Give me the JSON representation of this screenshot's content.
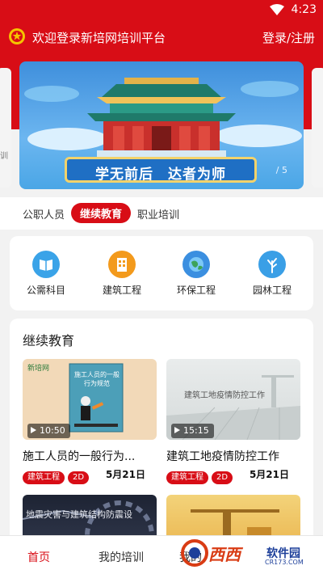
{
  "status": {
    "time": "4:23"
  },
  "header": {
    "title": "欢迎登录新培网培训平台",
    "login": "登录/注册"
  },
  "banner": {
    "slogan": "学无前后　达者为师",
    "counter": "/ 5",
    "side_text": "训"
  },
  "tabs": [
    "公职人员",
    "继续教育",
    "职业培训"
  ],
  "categories": [
    {
      "label": "公需科目",
      "color": "#3aa3e8",
      "icon": "book-icon"
    },
    {
      "label": "建筑工程",
      "color": "#f39a1c",
      "icon": "building-icon"
    },
    {
      "label": "环保工程",
      "color": "#3b8fe0",
      "icon": "globe-icon"
    },
    {
      "label": "园林工程",
      "color": "#3a9fe6",
      "icon": "tree-icon"
    }
  ],
  "section": {
    "title": "继续教育"
  },
  "courses": [
    {
      "title": "施工人员的一般行为...",
      "duration": "10:50",
      "tag1": "建筑工程",
      "tag2": "2D",
      "date": "5月21日",
      "thumb_text": "施工人员的一般行为规范",
      "thumb_brand": "新培网"
    },
    {
      "title": "建筑工地疫情防控工作",
      "duration": "15:15",
      "tag1": "建筑工程",
      "tag2": "2D",
      "date": "5月21日",
      "thumb_text": "建筑工地疫情防控工作"
    },
    {
      "thumb_text": "地震灾害与建筑结构防震设"
    },
    {
      "thumb_text": ""
    }
  ],
  "nav": [
    "首页",
    "我的培训",
    "我的"
  ],
  "watermark": {
    "text": "西西",
    "sub": "软件园",
    "url": "CR173.COM"
  },
  "colors": {
    "brand_red": "#d80d16"
  }
}
